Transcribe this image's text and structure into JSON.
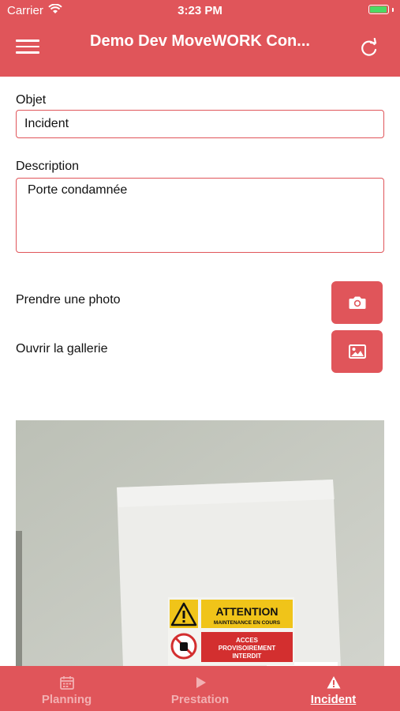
{
  "status_bar": {
    "carrier": "Carrier",
    "time": "3:23 PM"
  },
  "header": {
    "title": "Demo Dev MoveWORK Con..."
  },
  "form": {
    "objet_label": "Objet",
    "objet_value": "Incident",
    "description_label": "Description",
    "description_value": "Porte condamnée"
  },
  "actions": {
    "take_photo_label": "Prendre une photo",
    "open_gallery_label": "Ouvrir la gallerie"
  },
  "photo": {
    "sign_title": "ATTENTION",
    "sign_subtitle": "MAINTENANCE EN COURS",
    "sign_line1": "ACCES",
    "sign_line2": "PROVISOIREMENT",
    "sign_line3": "INTERDIT"
  },
  "tabs": [
    {
      "label": "Planning",
      "icon": "calendar-icon",
      "active": false
    },
    {
      "label": "Prestation",
      "icon": "play-icon",
      "active": false
    },
    {
      "label": "Incident",
      "icon": "warning-icon",
      "active": true
    }
  ],
  "colors": {
    "brand": "#e0555a",
    "battery": "#4cd964"
  }
}
